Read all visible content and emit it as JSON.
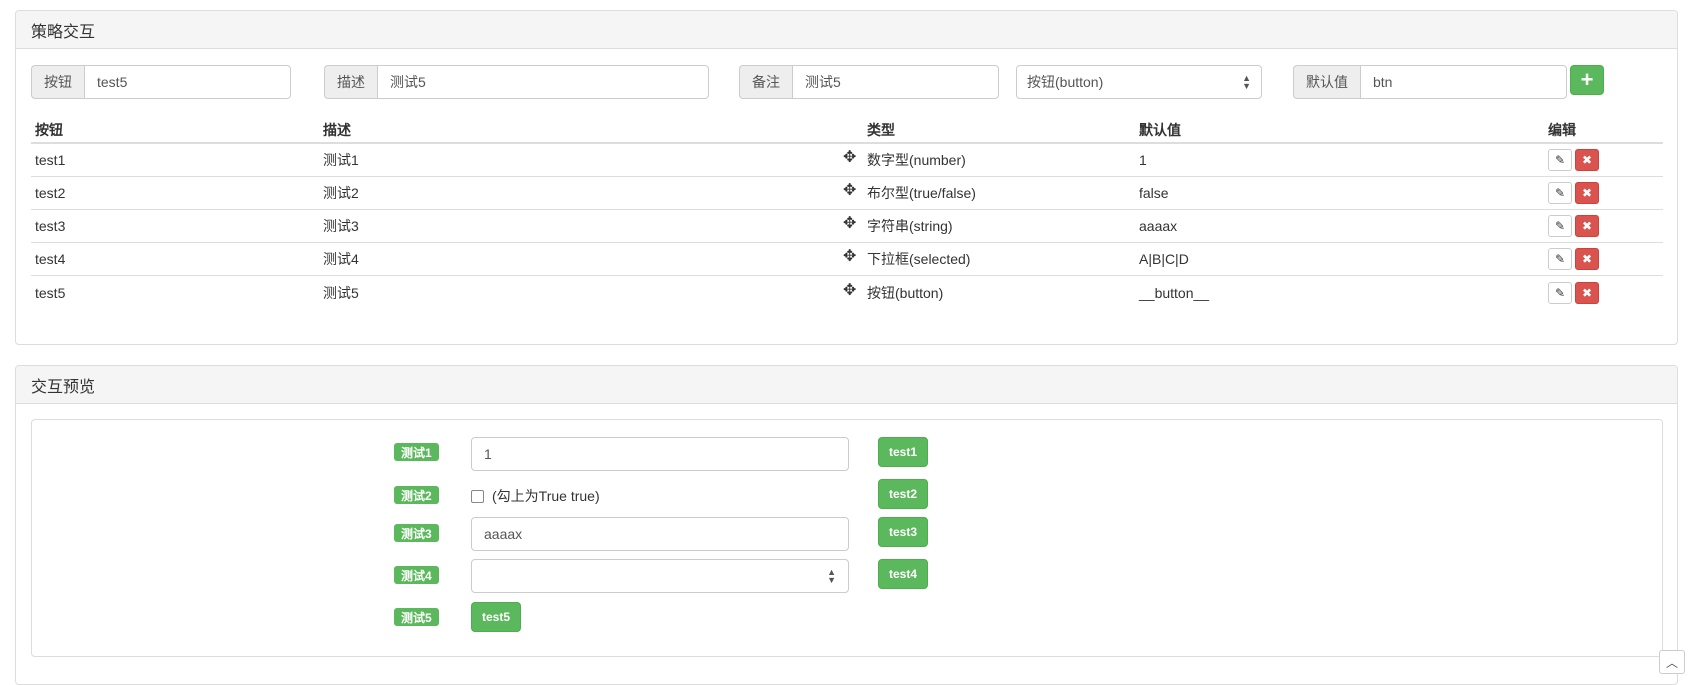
{
  "strategy_panel": {
    "title": "策略交互",
    "form": {
      "button_label": "按钮",
      "button_value": "test5",
      "desc_label": "描述",
      "desc_value": "测试5",
      "note_label": "备注",
      "note_value": "测试5",
      "type_selected": "按钮(button)",
      "default_label": "默认值",
      "default_value": "btn",
      "add_icon": "plus-icon"
    },
    "table": {
      "headers": [
        "按钮",
        "描述",
        "类型",
        "默认值",
        "编辑"
      ],
      "rows": [
        {
          "button": "test1",
          "desc": "测试1",
          "type": "数字型(number)",
          "default": "1"
        },
        {
          "button": "test2",
          "desc": "测试2",
          "type": "布尔型(true/false)",
          "default": "false"
        },
        {
          "button": "test3",
          "desc": "测试3",
          "type": "字符串(string)",
          "default": "aaaax"
        },
        {
          "button": "test4",
          "desc": "测试4",
          "type": "下拉框(selected)",
          "default": "A|B|C|D"
        },
        {
          "button": "test5",
          "desc": "测试5",
          "type": "按钮(button)",
          "default": "__button__"
        }
      ]
    }
  },
  "preview_panel": {
    "title": "交互预览",
    "items": [
      {
        "label": "测试1",
        "value": "1",
        "button": "test1"
      },
      {
        "label": "测试2",
        "checkbox_text": "(勾上为True true)",
        "button": "test2"
      },
      {
        "label": "测试3",
        "value": "aaaax",
        "button": "test3"
      },
      {
        "label": "测试4",
        "value": "",
        "button": "test4"
      },
      {
        "label": "测试5",
        "button": "test5"
      }
    ]
  },
  "colors": {
    "success": "#5cb85c",
    "danger": "#d9534f",
    "border": "#dddddd",
    "heading_bg": "#f5f5f5"
  }
}
